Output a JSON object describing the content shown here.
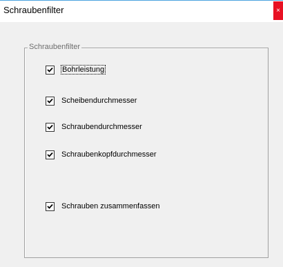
{
  "window": {
    "title": "Schraubenfilter",
    "close_label": "×"
  },
  "group": {
    "label": "Schraubenfilter"
  },
  "options": [
    {
      "label": "Bohrleistung",
      "checked": true,
      "focused": true
    },
    {
      "label": "Scheibendurchmesser",
      "checked": true,
      "focused": false
    },
    {
      "label": "Schraubendurchmesser",
      "checked": true,
      "focused": false
    },
    {
      "label": "Schraubenkopfdurchmesser",
      "checked": true,
      "focused": false
    },
    {
      "label": "Schrauben zusammenfassen",
      "checked": true,
      "focused": false
    }
  ],
  "colors": {
    "title_accent": "#4aa3df",
    "close_button": "#e81123",
    "dialog_background": "#f0f0f0"
  }
}
